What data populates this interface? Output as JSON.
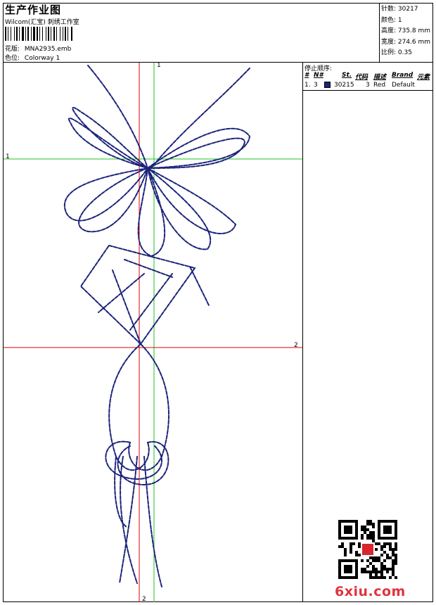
{
  "header": {
    "title": "生产作业图",
    "company": "Wilcom(汇宝) 刺绣工作室",
    "design_label": "花版:",
    "design_file": "MNA2935.emb",
    "colorway_label": "色位:",
    "colorway": "Colorway 1"
  },
  "stats": {
    "stitches": "针数: 30217",
    "colors": "颜色: 1",
    "height": "高度: 735.8 mm",
    "width": "宽度: 274.6 mm",
    "scale": "比例: 0.35"
  },
  "stop_sequence": {
    "title": "停止顺序:",
    "columns": [
      "#",
      "N#",
      "St.",
      "代码",
      "描述",
      "Brand",
      "元素"
    ],
    "rows": [
      {
        "index": "1.",
        "needle": "3",
        "stitches": "30215",
        "code": "3",
        "desc": "Red",
        "brand": "Default",
        "swatch_color": "#1b237a"
      }
    ]
  },
  "axes": {
    "v1_label": "1",
    "h1_label": "1",
    "h2_label": "2",
    "v2_label": "2"
  },
  "watermark": "6xiu.com",
  "colors": {
    "stitch": "#1b237a",
    "axis_red": "#e00000",
    "axis_green": "#22c322"
  }
}
